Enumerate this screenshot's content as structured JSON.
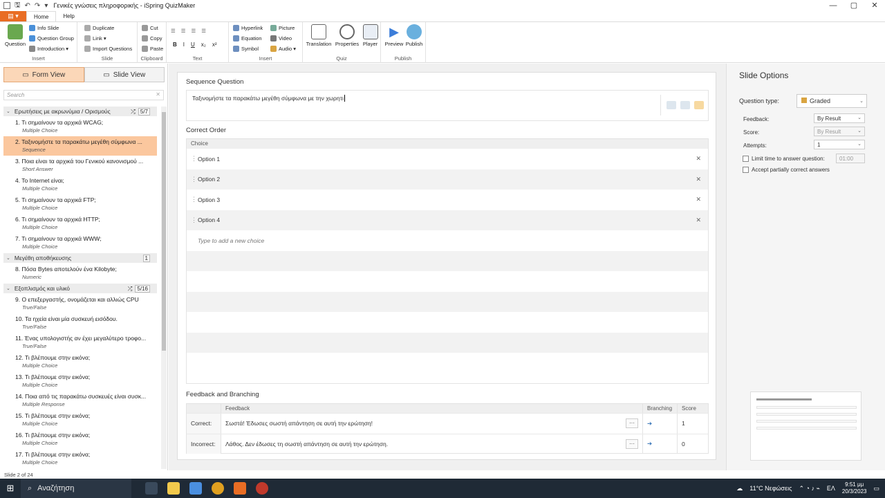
{
  "window": {
    "title": "Γενικές γνώσεις πληροφορικής - iSpring QuizMaker",
    "minimize": "—",
    "maximize": "▢",
    "close": "✕"
  },
  "tabs": {
    "file": "▤ ▾",
    "home": "Home",
    "help": "Help"
  },
  "ribbon": {
    "insert": {
      "label": "Insert",
      "question": "Question",
      "info_slide": "Info Slide",
      "question_group": "Question Group",
      "introduction": "Introduction ▾"
    },
    "slide": {
      "label": "Slide",
      "duplicate": "Duplicate",
      "link": "Link ▾",
      "import_questions": "Import Questions"
    },
    "clipboard": {
      "label": "Clipboard",
      "cut": "Cut",
      "copy": "Copy",
      "paste": "Paste"
    },
    "text": {
      "label": "Text",
      "bold": "B",
      "italic": "I",
      "underline": "U",
      "subscript": "x₂",
      "superscript": "x²"
    },
    "insert2": {
      "label": "Insert",
      "hyperlink": "Hyperlink",
      "equation": "Equation",
      "symbol": "Symbol",
      "picture": "Picture",
      "video": "Video",
      "audio": "Audio ▾"
    },
    "quiz": {
      "label": "Quiz",
      "translation": "Translation",
      "properties": "Properties",
      "player": "Player"
    },
    "publish": {
      "label": "Publish",
      "preview": "Preview",
      "publish": "Publish"
    }
  },
  "left": {
    "form_view": "Form View",
    "slide_view": "Slide View",
    "search_placeholder": "Search",
    "groups": [
      {
        "name": "Ερωτήσεις με ακρωνύμια / Ορισμούς",
        "count": "5/7",
        "shuffle": true,
        "items": [
          {
            "title": "1. Τι σημαίνουν τα αρχικά WCAG;",
            "type": "Multiple Choice"
          },
          {
            "title": "2. Ταξινομήστε τα παρακάτω μεγέθη σύμφωνα ...",
            "type": "Sequence",
            "selected": true
          },
          {
            "title": "3. Ποια είναι τα αρχικά του Γενικού κανονισμού ...",
            "type": "Short Answer"
          },
          {
            "title": "4. Το Internet είναι;",
            "type": "Multiple Choice"
          },
          {
            "title": "5. Τι σημαίνουν τα αρχικά FTP;",
            "type": "Multiple Choice"
          },
          {
            "title": "6. Τι σημαίνουν τα αρχικά HTTP;",
            "type": "Multiple Choice"
          },
          {
            "title": "7. Τι σημαίνουν τα αρχικά WWW;",
            "type": "Multiple Choice"
          }
        ]
      },
      {
        "name": "Μεγέθη αποθήκευσης",
        "count": "1",
        "shuffle": false,
        "items": [
          {
            "title": "8. Πόσα Bytes αποτελούν ένα Kilobyte;",
            "type": "Numeric"
          }
        ]
      },
      {
        "name": "Εξοπλισμός και υλικό",
        "count": "5/16",
        "shuffle": true,
        "items": [
          {
            "title": "9. Ο επεξεργαστής, ονομάζεται και αλλιώς CPU",
            "type": "True/False"
          },
          {
            "title": "10. Τα ηχεία είναι μία συσκευή εισόδου.",
            "type": "True/False"
          },
          {
            "title": "11. Ένας υπολογιστής αν έχει μεγαλύτερο τροφο...",
            "type": "True/False"
          },
          {
            "title": "12. Τι βλέπουμε στην εικόνα;",
            "type": "Multiple Choice"
          },
          {
            "title": "13. Τι βλέπουμε στην εικόνα;",
            "type": "Multiple Choice"
          },
          {
            "title": "14. Ποια από τις παρακάτω συσκευές είναι συσκ...",
            "type": "Multiple Response"
          },
          {
            "title": "15. Τι βλέπουμε στην εικόνα;",
            "type": "Multiple Choice"
          },
          {
            "title": "16. Τι βλέπουμε στην εικόνα;",
            "type": "Multiple Choice"
          },
          {
            "title": "17. Τι βλέπουμε στην εικόνα;",
            "type": "Multiple Choice"
          }
        ]
      }
    ],
    "status": "Slide 2 of 24"
  },
  "center": {
    "question_heading": "Sequence Question",
    "question_text": "Ταξινομήστε τα παρακάτω μεγέθη σύμφωνα με την χωρητι",
    "correct_order": "Correct Order",
    "choice_header": "Choice",
    "choices": [
      "Option 1",
      "Option 2",
      "Option 3",
      "Option 4"
    ],
    "add_choice": "Type to add a new choice",
    "feedback_heading": "Feedback and Branching",
    "fb_headers": {
      "feedback": "Feedback",
      "branching": "Branching",
      "score": "Score"
    },
    "fb_rows": [
      {
        "label": "Correct:",
        "text": "Σωστά! Έδωσες σωστή απάντηση σε αυτή την ερώτηση!",
        "score": "1"
      },
      {
        "label": "Incorrect:",
        "text": "Λάθος. Δεν έδωσες τη σωστή απάντηση σε αυτή την ερώτηση.",
        "score": "0"
      }
    ]
  },
  "right": {
    "title": "Slide Options",
    "question_type_label": "Question type:",
    "question_type": "Graded",
    "feedback_label": "Feedback:",
    "feedback": "By Result",
    "score_label": "Score:",
    "score": "By Result",
    "attempts_label": "Attempts:",
    "attempts": "1",
    "limit_time": "Limit time to answer question:",
    "time": "01:00",
    "partial": "Accept partially correct answers"
  },
  "taskbar": {
    "search": "Αναζήτηση",
    "weather": "11°C Νεφώσεις",
    "lang": "ΕΛ",
    "time": "9:51 μμ",
    "date": "20/3/2023"
  },
  "colors": {
    "accent": "#e96d24",
    "selected": "#fbc79e"
  }
}
